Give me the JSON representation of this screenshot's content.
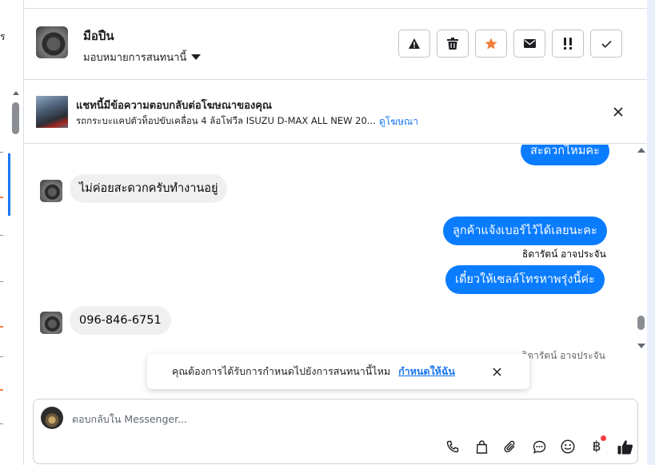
{
  "left_panel": {
    "cut_text": "ร"
  },
  "header": {
    "contact_name": "มือปืน",
    "assign_label": "มอบหมายการสนทนานี้",
    "actions": [
      {
        "name": "report-button",
        "icon": "warning-icon"
      },
      {
        "name": "delete-button",
        "icon": "trash-icon"
      },
      {
        "name": "star-button",
        "icon": "star-icon"
      },
      {
        "name": "unread-button",
        "icon": "envelope-icon"
      },
      {
        "name": "follow-up-button",
        "icon": "follow-up-icon"
      },
      {
        "name": "done-button",
        "icon": "check-icon"
      }
    ],
    "star_color": "#f5803e"
  },
  "ad_banner": {
    "title": "แชทนี้มีข้อความตอบกลับต่อโฆษณาของคุณ",
    "subtitle": "รถกระบะแคปตัวท็อปขับเคลื่อน 4 ล้อโฟวีล ISUZU D-MAX ALL NEW 20...",
    "link": "ดูโฆษณา"
  },
  "messages": [
    {
      "dir": "out",
      "text": "สะดวกไหมคะ"
    },
    {
      "dir": "in",
      "text": "ไม่ค่อยสะดวกครับทำงานอยู่"
    },
    {
      "dir": "out",
      "text": "ลูกค้าแจ้งเบอร์ไว้ได้เลยนะคะ"
    },
    {
      "dir": "sender",
      "text": "ธิดารัตน์ อาจประจัน"
    },
    {
      "dir": "out",
      "text": "เดี๋ยวให้เซลล์โทรหาพรุ่งนี้ค่ะ"
    },
    {
      "dir": "in",
      "text": "096-846-6751"
    },
    {
      "dir": "sender",
      "text": "ธิดารัตน์ อาจประจัน"
    }
  ],
  "toast": {
    "text": "คุณต้องการได้รับการกำหนดไปยังการสนทนานี้ไหม",
    "link": "กำหนดให้ฉัน"
  },
  "composer": {
    "placeholder": "ตอบกลับใน Messenger...",
    "tools": [
      "phone-icon",
      "bag-icon",
      "paperclip-icon",
      "chat-bubble-icon",
      "emoji-icon",
      "baht-icon",
      "thumbs-up-icon"
    ],
    "baht_symbol": "฿"
  },
  "colors": {
    "accent": "#0a7cff",
    "link": "#1877f2",
    "notify": "#fa383e"
  }
}
